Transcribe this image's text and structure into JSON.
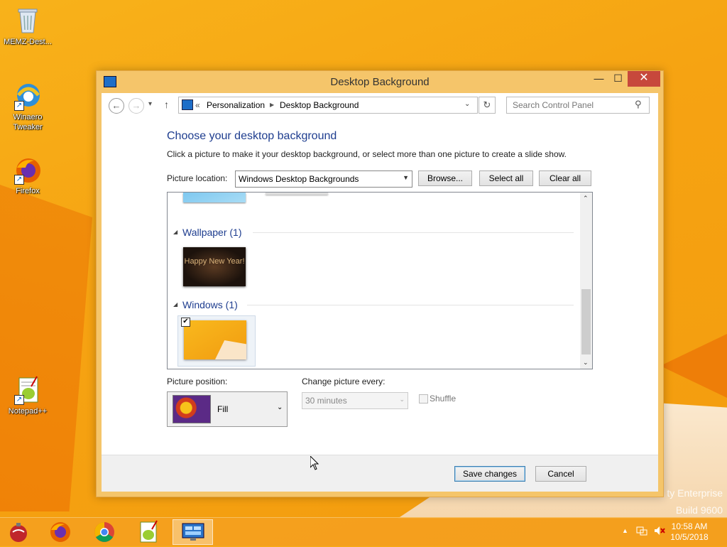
{
  "desktop": {
    "icons": [
      {
        "label": "MEMZ-Dest..."
      },
      {
        "label": "Winaero Tweaker"
      },
      {
        "label": "Firefox"
      },
      {
        "label": "Notepad++"
      }
    ],
    "watermark": {
      "line1": "ty Enterprise",
      "line2": "Build 9600"
    }
  },
  "window": {
    "title": "Desktop Background",
    "controls": {
      "minimize": "—",
      "maximize": "☐",
      "close": "✕"
    }
  },
  "nav": {
    "back": "←",
    "forward": "→",
    "recent": "▾",
    "up": "↑",
    "breadcrumb_prefix": "«",
    "breadcrumb": [
      "Personalization",
      "Desktop Background"
    ],
    "search_placeholder": "Search Control Panel"
  },
  "main": {
    "heading": "Choose your desktop background",
    "description": "Click a picture to make it your desktop background, or select more than one picture to create a slide show.",
    "picture_location_label": "Picture location:",
    "picture_location_value": "Windows Desktop Backgrounds",
    "browse_label": "Browse...",
    "select_all_label": "Select all",
    "clear_all_label": "Clear all"
  },
  "groups": [
    {
      "name": "Wallpaper (1)",
      "thumb_text": "Happy New Year!"
    },
    {
      "name": "Windows (1)",
      "checked": true
    }
  ],
  "position": {
    "label": "Picture position:",
    "value": "Fill"
  },
  "slideshow": {
    "change_label": "Change picture every:",
    "interval": "30 minutes",
    "shuffle_label": "Shuffle"
  },
  "footer": {
    "save_label": "Save changes",
    "cancel_label": "Cancel"
  },
  "tray": {
    "time": "10:58 AM",
    "date": "10/5/2018"
  }
}
